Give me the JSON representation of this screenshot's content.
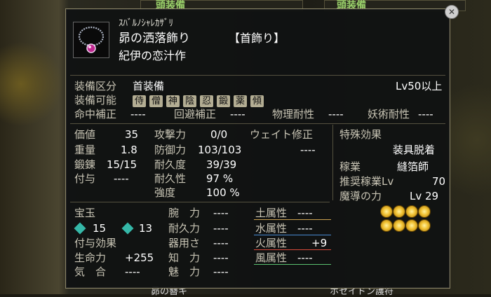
{
  "background": {
    "top_tabs": [
      "頭装備",
      "頭装備"
    ],
    "bottom_labels": [
      "昴の簪キ",
      "ホセイドン護符"
    ]
  },
  "item": {
    "ruby": "ｽﾊﾞﾙﾉｼｬﾚｶｻﾞﾘ",
    "name": "昴の洒落飾り",
    "type": "【首飾り】",
    "maker": "紀伊の恋汁作"
  },
  "equip": {
    "category_label": "装備区分",
    "category_value": "首装備",
    "level_req": "Lv50以上",
    "usable_label": "装備可能",
    "classes": [
      "侍",
      "僧",
      "神",
      "陰",
      "忍",
      "鍛",
      "薬",
      "傾"
    ]
  },
  "modifiers": [
    {
      "label": "命中補正",
      "value": "----"
    },
    {
      "label": "回避補正",
      "value": "----"
    },
    {
      "label": "物理耐性",
      "value": "----"
    },
    {
      "label": "妖術耐性",
      "value": "----"
    }
  ],
  "stats_left": [
    {
      "label": "価値",
      "value": "35"
    },
    {
      "label": "重量",
      "value": "1.8"
    },
    {
      "label": "鍛錬",
      "value": "15/15"
    },
    {
      "label": "付与",
      "value": "----"
    }
  ],
  "stats_mid": [
    {
      "label": "攻撃力",
      "value": "0/0"
    },
    {
      "label": "防御力",
      "value": "103/103"
    },
    {
      "label": "耐久度",
      "value": "39/39"
    },
    {
      "label": "耐久性",
      "value": "97 %"
    },
    {
      "label": "強度",
      "value": "100 %"
    }
  ],
  "weight_mod": {
    "label": "ウェイト修正",
    "value": "----"
  },
  "special": {
    "label": "特殊効果",
    "effect": "装具脱着",
    "job_label": "稼業",
    "job_value": "縫箔師",
    "rec_label": "推奨稼業Lv",
    "rec_value": "70",
    "magic_label": "魔導の力",
    "magic_value": "Lv 29"
  },
  "gems": {
    "label": "宝玉",
    "count1": "15",
    "count2": "13",
    "colors": {
      "gem": "#35b8a8"
    }
  },
  "enchant": {
    "label": "付与効果",
    "rows": [
      {
        "label": "生命力",
        "value": "+255"
      },
      {
        "label": "気　合",
        "value": "----"
      }
    ]
  },
  "attrs": [
    {
      "label": "腕　力",
      "value": "----"
    },
    {
      "label": "耐久力",
      "value": "----"
    },
    {
      "label": "器用さ",
      "value": "----"
    },
    {
      "label": "知　力",
      "value": "----"
    },
    {
      "label": "魅　力",
      "value": "----"
    }
  ],
  "elements": [
    {
      "label": "土属性",
      "value": "----",
      "color": "#c8a050"
    },
    {
      "label": "水属性",
      "value": "----",
      "color": "#4a8cd8"
    },
    {
      "label": "火属性",
      "value": "+9",
      "color": "#d84a3a"
    },
    {
      "label": "風属性",
      "value": "----",
      "color": "#5ac070"
    }
  ]
}
